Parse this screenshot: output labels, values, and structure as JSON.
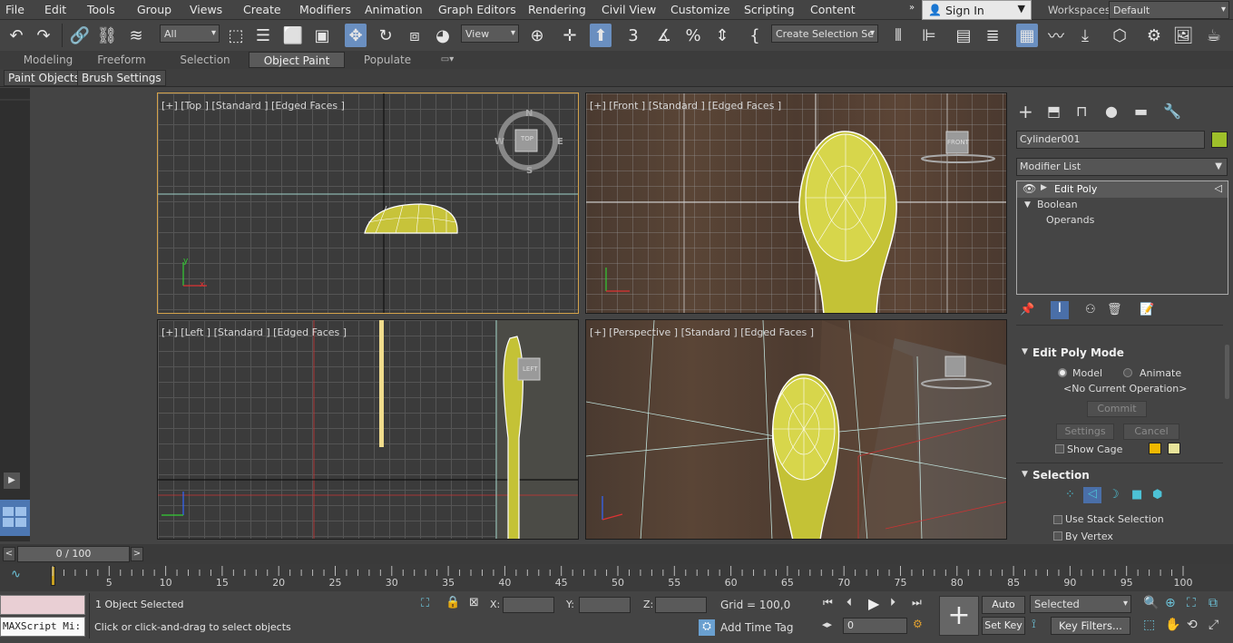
{
  "menu": [
    "File",
    "Edit",
    "Tools",
    "Group",
    "Views",
    "Create",
    "Modifiers",
    "Animation",
    "Graph Editors",
    "Rendering",
    "Civil View",
    "Customize",
    "Scripting",
    "Content"
  ],
  "sign_in": "Sign In",
  "workspaces": {
    "label": "Workspaces:",
    "value": "Default"
  },
  "toolbar": {
    "selection_filter": "All",
    "ref_coord": "View",
    "named_selection": "Create Selection Se"
  },
  "ribbon": {
    "tabs": [
      "Modeling",
      "Freeform",
      "Selection",
      "Object Paint",
      "Populate"
    ],
    "active_tab": "Object Paint",
    "subpanels": [
      "Paint Objects",
      "Brush Settings"
    ]
  },
  "viewports": {
    "top": "[+] [Top ] [Standard ] [Edged Faces ]",
    "front": "[+] [Front ] [Standard ] [Edged Faces ]",
    "left": "[+] [Left ] [Standard ] [Edged Faces ]",
    "persp": "[+] [Perspective ] [Standard ] [Edged Faces ]",
    "viewcube_top": "TOP",
    "viewcube_front": "FRONT",
    "viewcube_left": "LEFT",
    "compass": {
      "n": "N",
      "s": "S",
      "e": "E",
      "w": "W"
    }
  },
  "command_panel": {
    "object_name": "Cylinder001",
    "object_color": "#9ec02a",
    "modifier_list": "Modifier List",
    "stack": [
      "Edit Poly",
      "Boolean",
      "Operands"
    ],
    "edit_poly_mode": {
      "title": "Edit Poly Mode",
      "model": "Model",
      "animate": "Animate",
      "current_op": "<No Current Operation>",
      "commit": "Commit",
      "settings": "Settings",
      "cancel": "Cancel",
      "show_cage": "Show Cage"
    },
    "selection": {
      "title": "Selection",
      "use_stack": "Use Stack Selection",
      "by_vertex": "By Vertex"
    }
  },
  "time_slider": {
    "label": "0 / 100",
    "progress": 0
  },
  "trackbar": {
    "ticks": [
      "5",
      "10",
      "15",
      "20",
      "25",
      "30",
      "35",
      "40",
      "45",
      "50",
      "55",
      "60",
      "65",
      "70",
      "75",
      "80",
      "85",
      "90",
      "95",
      "100"
    ]
  },
  "status": {
    "maxscript": "MAXScript Mi:",
    "objects_selected": "1 Object Selected",
    "prompt": "Click or click-and-drag to select objects",
    "x_label": "X:",
    "y_label": "Y:",
    "z_label": "Z:",
    "grid": "Grid = 100,0",
    "add_time_tag": "Add Time Tag",
    "frame": "0",
    "auto_key": "Auto Key",
    "set_key": "Set Key",
    "key_mode": "Selected",
    "key_filters": "Key Filters..."
  }
}
